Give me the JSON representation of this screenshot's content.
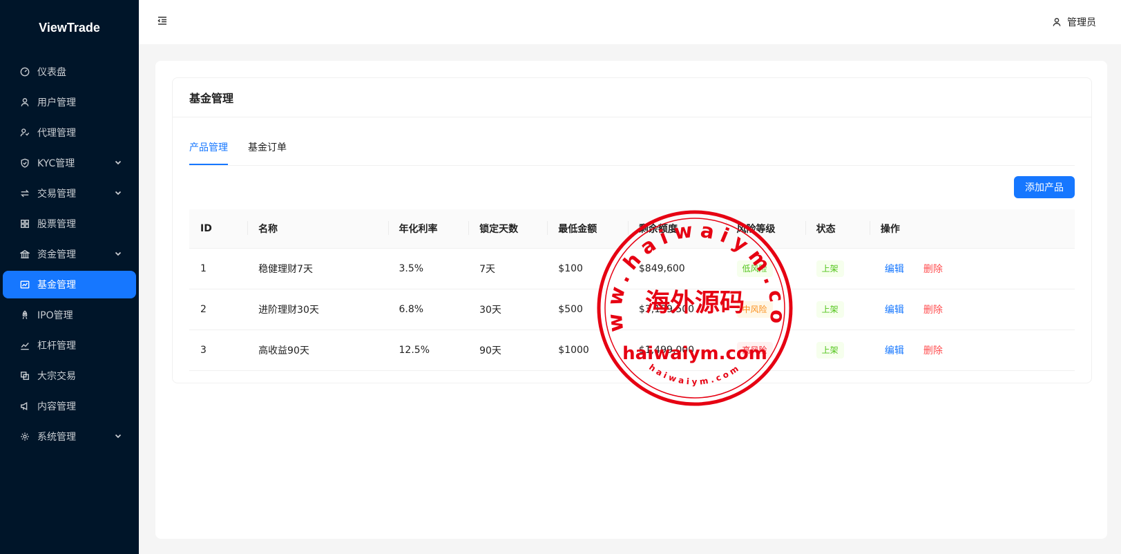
{
  "app": {
    "brand": "ViewTrade"
  },
  "sidebar": {
    "items": [
      {
        "label": "仪表盘",
        "icon": "dashboard-icon",
        "expandable": false,
        "active": false
      },
      {
        "label": "用户管理",
        "icon": "user-icon",
        "expandable": false,
        "active": false
      },
      {
        "label": "代理管理",
        "icon": "agent-icon",
        "expandable": false,
        "active": false
      },
      {
        "label": "KYC管理",
        "icon": "shield-icon",
        "expandable": true,
        "active": false
      },
      {
        "label": "交易管理",
        "icon": "swap-icon",
        "expandable": true,
        "active": false
      },
      {
        "label": "股票管理",
        "icon": "grid-icon",
        "expandable": false,
        "active": false
      },
      {
        "label": "资金管理",
        "icon": "bank-icon",
        "expandable": true,
        "active": false
      },
      {
        "label": "基金管理",
        "icon": "fund-chart-icon",
        "expandable": false,
        "active": true
      },
      {
        "label": "IPO管理",
        "icon": "rocket-icon",
        "expandable": false,
        "active": false
      },
      {
        "label": "杠杆管理",
        "icon": "line-chart-icon",
        "expandable": false,
        "active": false
      },
      {
        "label": "大宗交易",
        "icon": "block-icon",
        "expandable": false,
        "active": false
      },
      {
        "label": "内容管理",
        "icon": "notification-icon",
        "expandable": false,
        "active": false
      },
      {
        "label": "系统管理",
        "icon": "settings-icon",
        "expandable": true,
        "active": false
      }
    ]
  },
  "header": {
    "user_label": "管理员"
  },
  "page": {
    "title": "基金管理",
    "tabs": [
      {
        "label": "产品管理",
        "active": true
      },
      {
        "label": "基金订单",
        "active": false
      }
    ],
    "add_button": "添加产品"
  },
  "table": {
    "columns": [
      "ID",
      "名称",
      "年化利率",
      "锁定天数",
      "最低金额",
      "剩余额度",
      "风险等级",
      "状态",
      "操作"
    ],
    "rows": [
      {
        "id": "1",
        "name": "稳健理财7天",
        "rate": "3.5%",
        "days": "7天",
        "min": "$100",
        "remaining": "$849,600",
        "risk": "低风险",
        "risk_level": "low",
        "status": "上架",
        "edit": "编辑",
        "delete": "删除"
      },
      {
        "id": "2",
        "name": "进阶理财30天",
        "rate": "6.8%",
        "days": "30天",
        "min": "$500",
        "remaining": "$3,199,500",
        "risk": "中风险",
        "risk_level": "mid",
        "status": "上架",
        "edit": "编辑",
        "delete": "删除"
      },
      {
        "id": "3",
        "name": "高收益90天",
        "rate": "12.5%",
        "days": "90天",
        "min": "$1000",
        "remaining": "$1,499,000",
        "risk": "高风险",
        "risk_level": "high",
        "status": "上架",
        "edit": "编辑",
        "delete": "删除"
      }
    ]
  },
  "watermark": {
    "arc_text": "www.haiwaiym.com",
    "center_text": "海外源码",
    "domain_text": "haiwaiym.com",
    "small_arc_text": "haiwaiym.com",
    "color": "#e60012"
  },
  "colors": {
    "sidebar_bg": "#001529",
    "accent": "#1677ff",
    "danger": "#ff4d4f",
    "success": "#52c41a",
    "warning": "#fa8c16"
  }
}
